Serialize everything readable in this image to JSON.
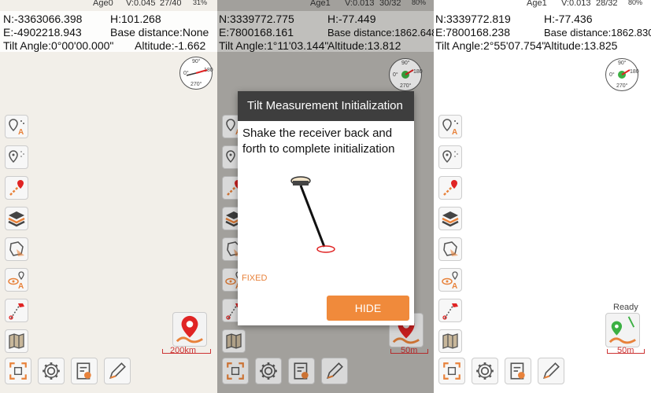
{
  "panels": [
    {
      "status": {
        "age": "Age0",
        "v": "V:0.045",
        "sats": "27/40",
        "battery": "31%"
      },
      "info": {
        "n": "N:-3363066.398",
        "h": "H:101.268",
        "e": "E:-4902218.943",
        "base": "Base distance:None",
        "tilt": "Tilt Angle:0°00'00.000\"",
        "alt": "Altitude:-1.662"
      },
      "compass": {
        "n": "90°",
        "e": "180",
        "w": "0°",
        "s": "270°"
      },
      "scale": "200km"
    },
    {
      "status": {
        "age": "Age1",
        "v": "V:0.013",
        "sats": "30/32",
        "battery": "80%"
      },
      "info": {
        "n": "N:3339772.775",
        "h": "H:-77.449",
        "e": "E:7800168.161",
        "base": "Base distance:1862.648",
        "tilt": "Tilt Angle:1°11'03.144\"",
        "alt": "Altitude:13.812"
      },
      "compass": {
        "n": "90°",
        "e": "180",
        "w": "0°",
        "s": "270°"
      },
      "scale": "50m"
    },
    {
      "status": {
        "age": "Age1",
        "v": "V:0.013",
        "sats": "28/32",
        "battery": "80%"
      },
      "info": {
        "n": "N:3339772.819",
        "h": "H:-77.436",
        "e": "E:7800168.238",
        "base": "Base distance:1862.830",
        "tilt": "Tilt Angle:2°55'07.754\"",
        "alt": "Altitude:13.825"
      },
      "compass": {
        "n": "90°",
        "e": "180",
        "w": "0°",
        "s": "270°"
      },
      "scale": "50m",
      "ready": "Ready"
    }
  ],
  "dialog": {
    "title": "Tilt Measurement Initialization",
    "message": "Shake the receiver back and forth to complete initialization",
    "status": "FIXED",
    "button": "HIDE"
  },
  "colors": {
    "accent": "#f08a3b",
    "dialog_header": "#3e3e3e",
    "fixed_text": "#e8823b",
    "pin_red": "#e02424",
    "ready_green": "#3cb043"
  }
}
